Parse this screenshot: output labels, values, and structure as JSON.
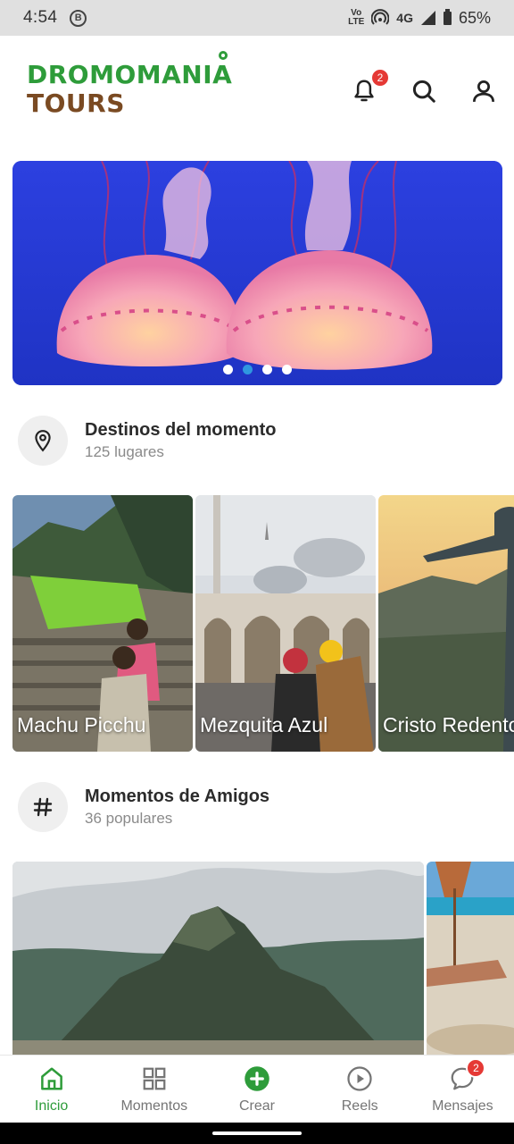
{
  "status_bar": {
    "time": "4:54",
    "b_icon": "B",
    "volte": "Vo\nLTE",
    "network": "4G",
    "battery": "65%"
  },
  "header": {
    "logo_line1": "DROMOMANIA",
    "logo_line2": "TOURS",
    "notification_count": "2",
    "icons": [
      "bell-icon",
      "search-icon",
      "user-icon"
    ],
    "colors": {
      "brand_green": "#2e9c3a",
      "brand_brown": "#7a4a22",
      "badge": "#e53935"
    }
  },
  "carousel": {
    "image": "jellyfish",
    "dots_total": 4,
    "active_dot": 1
  },
  "destinos": {
    "title": "Destinos del momento",
    "subtitle": "125 lugares",
    "icon": "location-pin-icon",
    "cards": [
      {
        "label": "Machu Picchu"
      },
      {
        "label": "Mezquita Azul"
      },
      {
        "label": "Cristo Redentor"
      }
    ]
  },
  "momentos": {
    "title": "Momentos de Amigos",
    "subtitle": "36 populares",
    "icon": "hashtag-icon"
  },
  "bottom_nav": {
    "items": [
      {
        "label": "Inicio",
        "icon": "home-icon",
        "active": true
      },
      {
        "label": "Momentos",
        "icon": "grid-icon"
      },
      {
        "label": "Crear",
        "icon": "plus-circle-icon"
      },
      {
        "label": "Reels",
        "icon": "play-circle-icon"
      },
      {
        "label": "Mensajes",
        "icon": "chat-bubble-icon",
        "badge": "2"
      }
    ]
  }
}
